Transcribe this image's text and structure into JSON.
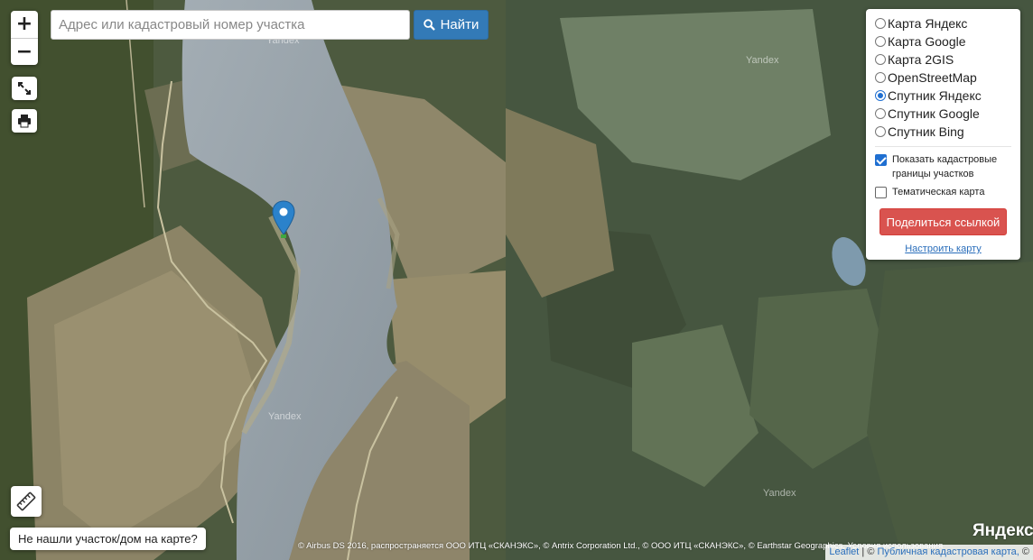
{
  "search": {
    "placeholder": "Адрес или кадастровый номер участка",
    "button_label": "Найти"
  },
  "zoom": {
    "in_label": "+",
    "out_label": "−"
  },
  "layers": [
    {
      "label": "Карта Яндекс",
      "selected": false
    },
    {
      "label": "Карта Google",
      "selected": false
    },
    {
      "label": "Карта 2GIS",
      "selected": false
    },
    {
      "label": "OpenStreetMap",
      "selected": false
    },
    {
      "label": "Спутник Яндекс",
      "selected": true
    },
    {
      "label": "Спутник Google",
      "selected": false
    },
    {
      "label": "Спутник Bing",
      "selected": false
    }
  ],
  "options": {
    "cadastral_label": "Показать кадастровые границы участков",
    "cadastral_checked": true,
    "thematic_label": "Тематическая карта",
    "thematic_checked": false
  },
  "panel": {
    "share_label": "Поделиться ссылкой",
    "settings_label": "Настроить карту"
  },
  "notfound_label": "Не нашли участок/дом на карте?",
  "attribution": "© Airbus DS 2016, распространяется ООО ИТЦ «СКАНЭКС», © Antrix Corporation Ltd., © ООО ИТЦ «СКАНЭКС», © Earthstar Geographics, Условия использования",
  "yandex_logo": "Яндекс",
  "watermark": "Yandex",
  "leaflet": {
    "link_label": "Leaflet",
    "sep": "| ©",
    "map_link_label": "Публичная кадастровая карта,",
    "suffix": "©"
  },
  "colors": {
    "search_btn": "#337ab7",
    "share_btn": "#d9534f",
    "marker": "#2b82cb",
    "water": "#8e9aa3"
  },
  "icons": {
    "search": "magnifier-icon",
    "fullscreen": "fullscreen-icon",
    "print": "printer-icon",
    "ruler": "ruler-icon",
    "marker": "map-marker-icon"
  }
}
